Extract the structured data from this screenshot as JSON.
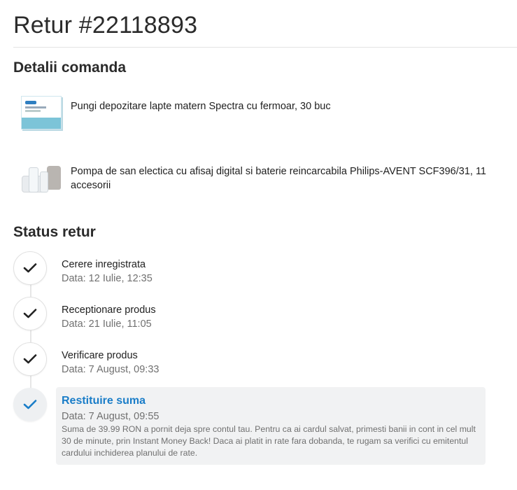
{
  "page": {
    "title": "Retur #22118893"
  },
  "details": {
    "heading": "Detalii comanda",
    "products": [
      {
        "name": "Pungi depozitare lapte matern Spectra cu fermoar, 30 buc",
        "thumbnail_icon": "spectra-box-image"
      },
      {
        "name": "Pompa de san electica cu afisaj digital si baterie reincarcabila Philips-AVENT SCF396/31, 11 accesorii",
        "thumbnail_icon": "breast-pump-image"
      }
    ]
  },
  "status": {
    "heading": "Status retur",
    "steps": [
      {
        "label": "Cerere inregistrata",
        "date": "Data: 12 Iulie, 12:35",
        "icon": "check-icon"
      },
      {
        "label": "Receptionare produs",
        "date": "Data: 21 Iulie, 11:05",
        "icon": "check-icon"
      },
      {
        "label": "Verificare produs",
        "date": "Data: 7 August, 09:33",
        "icon": "check-icon"
      },
      {
        "label": "Restituire suma",
        "date": "Data: 7 August, 09:55",
        "icon": "check-icon",
        "message": "Suma de 39.99 RON a pornit deja spre contul tau. Pentru ca ai cardul salvat, primesti banii in cont in cel mult 30 de minute, prin Instant Money Back! Daca ai platit in rate fara dobanda, te rugam sa verifici cu emitentul cardului inchiderea planului de rate."
      }
    ]
  },
  "colors": {
    "accent": "#1a7dc8",
    "check_dark": "#222222",
    "panel_bg": "#f1f2f3",
    "muted_text": "#707070"
  }
}
